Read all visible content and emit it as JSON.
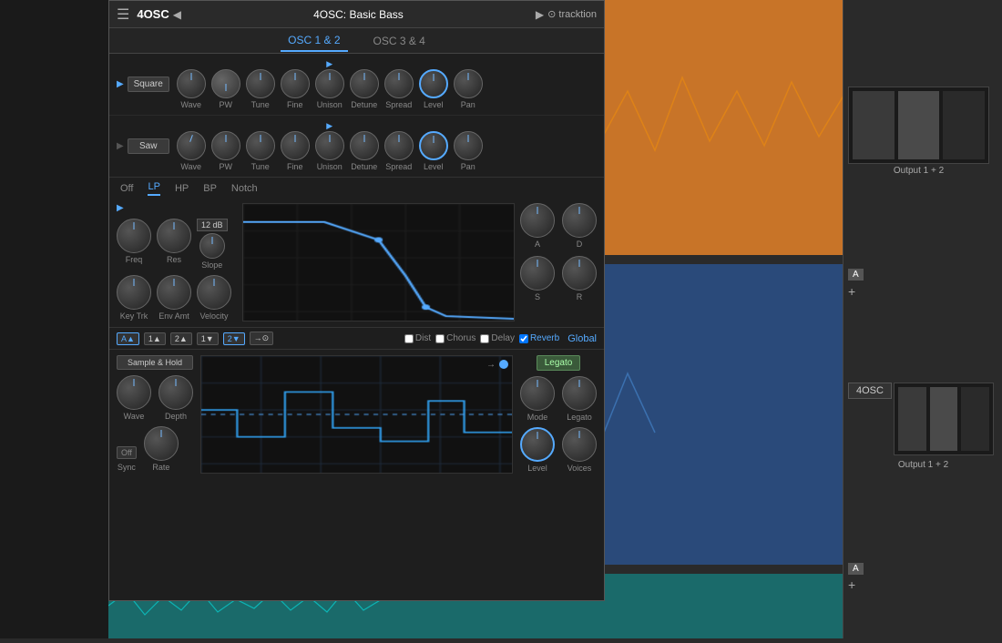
{
  "app": {
    "title": "4OSC",
    "preset": "4OSC: Basic Bass",
    "logo": "tracktion"
  },
  "tabs": {
    "osc12": "OSC 1 & 2",
    "osc34": "OSC 3 & 4"
  },
  "osc1": {
    "type": "Square",
    "knobs": [
      "Wave",
      "PW",
      "Tune",
      "Fine",
      "Unison",
      "Detune",
      "Spread",
      "Level",
      "Pan"
    ]
  },
  "osc2": {
    "type": "Saw",
    "knobs": [
      "Wave",
      "PW",
      "Tune",
      "Fine",
      "Unison",
      "Detune",
      "Spread",
      "Level",
      "Pan"
    ]
  },
  "filter": {
    "tabs": [
      "Off",
      "LP",
      "HP",
      "BP",
      "Notch"
    ],
    "active": "LP",
    "slope": "12 dB",
    "knobs_row1": [
      "Freq",
      "Res",
      "Slope"
    ],
    "knobs_row2": [
      "Key Trk",
      "Env Amt",
      "Velocity"
    ]
  },
  "adsr": {
    "labels": [
      "A",
      "D",
      "S",
      "R"
    ]
  },
  "routing": {
    "buttons": [
      "A▲",
      "1▲",
      "2▲",
      "1▼",
      "2▼",
      "→⊙"
    ]
  },
  "fx": {
    "dist": "Dist",
    "chorus": "Chorus",
    "delay": "Delay",
    "reverb": "Reverb",
    "reverb_checked": true,
    "global": "Global"
  },
  "lfo": {
    "type": "Sample & Hold",
    "knobs": [
      "Wave",
      "Depth"
    ],
    "sync_label": "Off",
    "sync_knob": "Rate",
    "bottom_labels": [
      "Sync",
      "Rate"
    ]
  },
  "voice": {
    "mode_btn": "Legato",
    "knobs": [
      "Mode",
      "Legato",
      "Level",
      "Voices"
    ]
  },
  "output": {
    "label1": "Output 1 + 2",
    "label2": "Output 1 + 2"
  },
  "plugin_name": "4OSC"
}
